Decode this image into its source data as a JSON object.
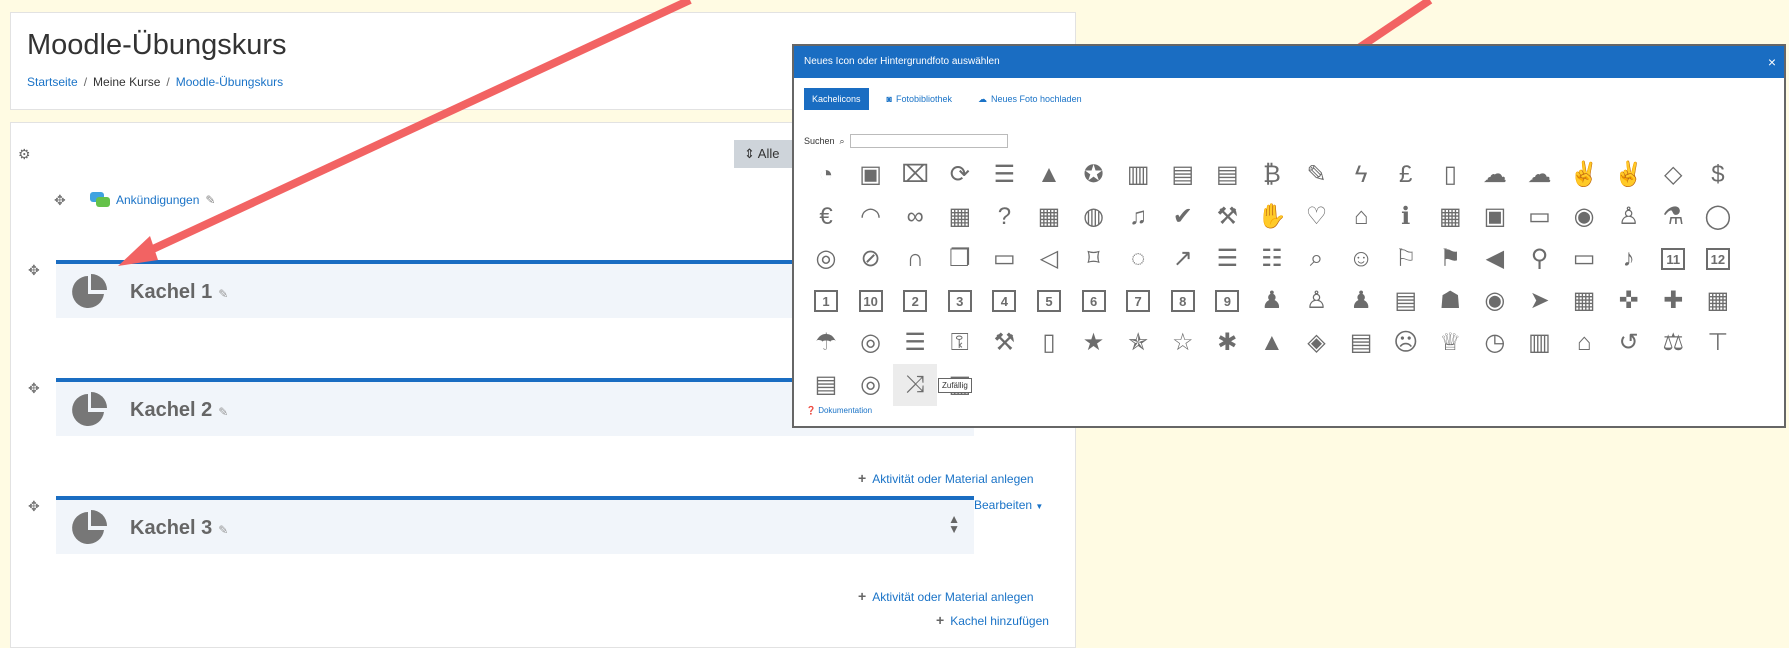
{
  "header": {
    "course_title": "Moodle-Übungskurs",
    "breadcrumb": [
      "Startseite",
      "Meine Kurse",
      "Moodle-Übungskurs"
    ]
  },
  "toolbar": {
    "alle_label": "Alle"
  },
  "announcement": {
    "label": "Ankündigungen"
  },
  "sections": [
    {
      "title": "Kachel 1"
    },
    {
      "title": "Kachel 2"
    },
    {
      "title": "Kachel 3"
    }
  ],
  "actions": {
    "add_activity": "Aktivität oder Material anlegen",
    "bearbeiten": "Bearbeiten",
    "add_tile": "Kachel hinzufügen"
  },
  "modal": {
    "title": "Neues Icon oder Hintergrundfoto auswählen",
    "close": "×",
    "tabs": [
      "Kachelicons",
      "Fotobibliothek",
      "Neues Foto hochladen"
    ],
    "search_label": "Suchen",
    "tooltip": "Zufällig",
    "doc_link": "Dokumentation"
  },
  "icons": [
    "pie-chart",
    "address-book",
    "briefcase",
    "refresh",
    "server",
    "warning",
    "award",
    "bar-chart",
    "file-a-plus",
    "file-clock",
    "bitcoin",
    "edit",
    "bolt",
    "pound",
    "book",
    "cloud-download",
    "cloud-upload",
    "thumbs-up",
    "thumbs-down",
    "diamond",
    "dollar",
    "euro",
    "rss",
    "binoculars",
    "film",
    "question",
    "building",
    "globe",
    "bell",
    "check",
    "gavel",
    "handshake",
    "heartbeat",
    "graduation-cap",
    "info",
    "calendar",
    "calendar-check",
    "map",
    "map-marker",
    "child",
    "flask",
    "comment",
    "comments",
    "compass",
    "headphones",
    "copy",
    "laptop",
    "volume",
    "bookmark",
    "lightbulb",
    "line-chart",
    "list",
    "ordered-list",
    "search",
    "smile",
    "flag",
    "flag-checkered",
    "bullhorn",
    "microphone",
    "desktop",
    "music",
    "num-11",
    "num-12",
    "num-1",
    "num-10",
    "num-2",
    "num-3",
    "num-4",
    "num-5",
    "num-6",
    "num-7",
    "num-8",
    "num-9",
    "user",
    "user-outline",
    "user-md",
    "id-card",
    "users",
    "podcast",
    "location-arrow",
    "presentation",
    "puzzle",
    "puzzle-piece",
    "calculator",
    "umbrella",
    "life-ring",
    "sliders",
    "key",
    "wrench",
    "mobile",
    "star",
    "star-half",
    "star-outline",
    "asterisk",
    "road",
    "tags",
    "file",
    "frown",
    "trophy",
    "clock",
    "bar-chart-small",
    "institution",
    "history",
    "balance",
    "signpost",
    "newspaper",
    "target",
    "random",
    "ticket"
  ],
  "icon_glyphs": {
    "pie-chart": "◔",
    "address-book": "▣",
    "briefcase": "⌧",
    "refresh": "⟳",
    "server": "☰",
    "warning": "▲",
    "award": "✪",
    "bar-chart": "▥",
    "file-a-plus": "▤",
    "file-clock": "▤",
    "bitcoin": "₿",
    "edit": "✎",
    "bolt": "ϟ",
    "pound": "£",
    "book": "▯",
    "cloud-download": "☁",
    "cloud-upload": "☁",
    "thumbs-up": "✌",
    "thumbs-down": "✌",
    "diamond": "◇",
    "dollar": "$",
    "euro": "€",
    "rss": "◠",
    "binoculars": "∞",
    "film": "▦",
    "question": "?",
    "building": "▦",
    "globe": "◍",
    "bell": "♫",
    "check": "✔",
    "gavel": "⚒",
    "handshake": "✋",
    "heartbeat": "♡",
    "graduation-cap": "⌂",
    "info": "ℹ",
    "calendar": "▦",
    "calendar-check": "▣",
    "map": "▭",
    "map-marker": "◉",
    "child": "♙",
    "flask": "⚗",
    "comment": "◯",
    "comments": "◎",
    "compass": "⊘",
    "headphones": "∩",
    "copy": "❐",
    "laptop": "▭",
    "volume": "◁",
    "bookmark": "⌑",
    "lightbulb": "◌",
    "line-chart": "↗",
    "list": "☰",
    "ordered-list": "☷",
    "search": "⌕",
    "smile": "☺",
    "flag": "⚐",
    "flag-checkered": "⚑",
    "bullhorn": "◀",
    "microphone": "⚲",
    "desktop": "▭",
    "music": "♪",
    "num-11": "11",
    "num-12": "12",
    "num-1": "1",
    "num-10": "10",
    "num-2": "2",
    "num-3": "3",
    "num-4": "4",
    "num-5": "5",
    "num-6": "6",
    "num-7": "7",
    "num-8": "8",
    "num-9": "9",
    "user": "♟",
    "user-outline": "♙",
    "user-md": "♟",
    "id-card": "▤",
    "users": "☗",
    "podcast": "◉",
    "location-arrow": "➤",
    "presentation": "▦",
    "puzzle": "✜",
    "puzzle-piece": "✚",
    "calculator": "▦",
    "umbrella": "☂",
    "life-ring": "◎",
    "sliders": "☰",
    "key": "⚿",
    "wrench": "⚒",
    "mobile": "▯",
    "star": "★",
    "star-half": "✯",
    "star-outline": "☆",
    "asterisk": "✱",
    "road": "▲",
    "tags": "◈",
    "file": "▤",
    "frown": "☹",
    "trophy": "♕",
    "clock": "◷",
    "bar-chart-small": "▥",
    "institution": "⌂",
    "history": "↺",
    "balance": "⚖",
    "signpost": "⊤",
    "newspaper": "▤",
    "target": "◎",
    "random": "⤨",
    "ticket": "▦"
  },
  "colors": {
    "primary": "#1a6dc2",
    "link": "#1a73c7",
    "icon": "#6c6c6c",
    "section_bg": "#f1f5fa",
    "page_bg": "#fffbe3",
    "arrow": "#f26363"
  }
}
